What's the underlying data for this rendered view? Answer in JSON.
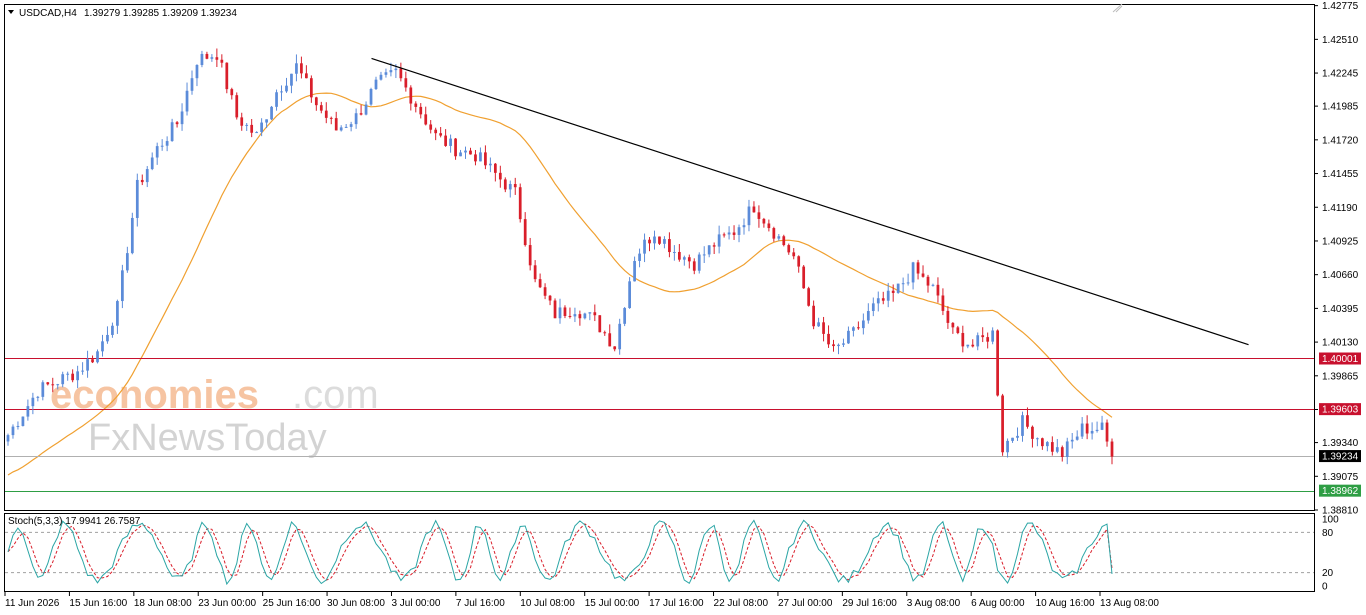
{
  "chart_data": {
    "type": "candlestick",
    "header": {
      "symbol_tf": "USDCAD,H4",
      "ohlc": "1.39279 1.39285 1.39209 1.39234"
    },
    "price_axis": {
      "ylim": [
        1.3881,
        1.4278
      ],
      "ticks": [
        "1.42775",
        "1.42510",
        "1.42245",
        "1.41985",
        "1.41720",
        "1.41455",
        "1.41190",
        "1.40925",
        "1.40660",
        "1.40395",
        "1.40130",
        "1.39865",
        "1.39600",
        "1.39340",
        "1.39075",
        "1.38810"
      ]
    },
    "time_axis": {
      "labels": [
        "11 Jun 2026",
        "15 Jun 16:00",
        "18 Jun 08:00",
        "23 Jun 00:00",
        "25 Jun 16:00",
        "30 Jun 08:00",
        "3 Jul 00:00",
        "7 Jul 16:00",
        "10 Jul 08:00",
        "15 Jul 00:00",
        "17 Jul 16:00",
        "22 Jul 08:00",
        "27 Jul 00:00",
        "29 Jul 16:00",
        "3 Aug 08:00",
        "6 Aug 00:00",
        "10 Aug 16:00",
        "13 Aug 08:00"
      ]
    },
    "levels": [
      {
        "label": "1.40001",
        "price": 1.40001,
        "color": "#c8102e"
      },
      {
        "label": "1.39603",
        "price": 1.39603,
        "color": "#c8102e"
      },
      {
        "label": "1.38962",
        "price": 1.38962,
        "color": "#2e9e44"
      }
    ],
    "current_price": {
      "label": "1.39234",
      "price": 1.39234
    },
    "trendline": {
      "start": {
        "bar": 0.28,
        "price": 1.4236
      },
      "end": {
        "bar": 0.95,
        "price": 1.4011
      }
    },
    "colors": {
      "up": "#5b8bd9",
      "down": "#d91e2a",
      "ma": "#f0a030",
      "stoch_main": "#2aa5a5",
      "stoch_signal": "#d91e2a"
    },
    "ohlc_keypoints": [
      [
        0,
        1.394
      ],
      [
        6,
        1.3975
      ],
      [
        14,
        1.399
      ],
      [
        18,
        1.4005
      ],
      [
        22,
        1.404
      ],
      [
        26,
        1.4135
      ],
      [
        30,
        1.4165
      ],
      [
        34,
        1.4185
      ],
      [
        38,
        1.4235
      ],
      [
        42,
        1.424
      ],
      [
        46,
        1.419
      ],
      [
        50,
        1.4175
      ],
      [
        54,
        1.421
      ],
      [
        58,
        1.423
      ],
      [
        62,
        1.42
      ],
      [
        66,
        1.418
      ],
      [
        70,
        1.419
      ],
      [
        74,
        1.4215
      ],
      [
        78,
        1.4225
      ],
      [
        82,
        1.42
      ],
      [
        86,
        1.4175
      ],
      [
        90,
        1.4165
      ],
      [
        94,
        1.416
      ],
      [
        98,
        1.4145
      ],
      [
        102,
        1.413
      ],
      [
        106,
        1.406
      ],
      [
        110,
        1.4035
      ],
      [
        114,
        1.404
      ],
      [
        118,
        1.403
      ],
      [
        122,
        1.401
      ],
      [
        126,
        1.408
      ],
      [
        130,
        1.41
      ],
      [
        134,
        1.4085
      ],
      [
        138,
        1.4075
      ],
      [
        142,
        1.409
      ],
      [
        146,
        1.41
      ],
      [
        150,
        1.412
      ],
      [
        154,
        1.41
      ],
      [
        158,
        1.408
      ],
      [
        162,
        1.403
      ],
      [
        166,
        1.4005
      ],
      [
        170,
        1.402
      ],
      [
        174,
        1.404
      ],
      [
        178,
        1.405
      ],
      [
        182,
        1.407
      ],
      [
        186,
        1.4055
      ],
      [
        190,
        1.402
      ],
      [
        194,
        1.401
      ],
      [
        198,
        1.402
      ],
      [
        200,
        1.393
      ],
      [
        204,
        1.395
      ],
      [
        208,
        1.3935
      ],
      [
        212,
        1.3925
      ],
      [
        216,
        1.3945
      ],
      [
        220,
        1.3945
      ],
      [
        222,
        1.3923
      ]
    ],
    "stochastic": {
      "label": "Stoch(5,3,3) 17.9941 26.7587",
      "ylim": [
        0,
        100
      ],
      "ticks": [
        "100",
        "80",
        "20",
        "0"
      ],
      "levels": [
        80,
        20
      ],
      "main": 17.9941,
      "signal": 26.7587
    }
  }
}
